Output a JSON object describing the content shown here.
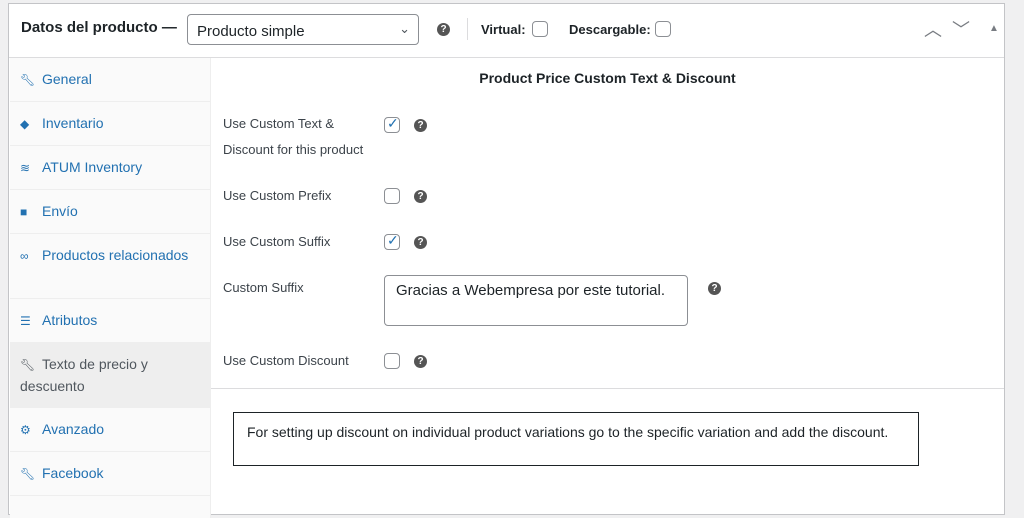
{
  "header": {
    "title": "Datos del producto —",
    "product_type": "Producto simple",
    "virtual_label": "Virtual:",
    "virtual_checked": false,
    "downloadable_label": "Descargable:",
    "downloadable_checked": false
  },
  "sidebar": {
    "items": [
      {
        "label": "General",
        "icon": "wrench-icon"
      },
      {
        "label": "Inventario",
        "icon": "tag-icon"
      },
      {
        "label": "ATUM Inventory",
        "icon": "layers-icon"
      },
      {
        "label": "Envío",
        "icon": "truck-icon"
      },
      {
        "label": "Productos relacionados",
        "icon": "link-icon"
      },
      {
        "label": "Atributos",
        "icon": "list-icon"
      },
      {
        "label": "Texto de precio y descuento",
        "icon": "wrench-icon",
        "active": true
      },
      {
        "label": "Avanzado",
        "icon": "gear-icon"
      },
      {
        "label": "Facebook",
        "icon": "wrench-icon"
      }
    ]
  },
  "main": {
    "title": "Product Price Custom Text & Discount",
    "fields": {
      "use_custom_text": {
        "label": "Use Custom Text & Discount for this product",
        "checked": true
      },
      "use_prefix": {
        "label": "Use Custom Prefix",
        "checked": false
      },
      "use_suffix": {
        "label": "Use Custom Suffix",
        "checked": true
      },
      "suffix": {
        "label": "Custom Suffix",
        "value": "Gracias a Webempresa por este tutorial."
      },
      "use_discount": {
        "label": "Use Custom Discount",
        "checked": false
      }
    },
    "note": "For setting up discount on individual product variations go to the specific variation and add the discount."
  }
}
